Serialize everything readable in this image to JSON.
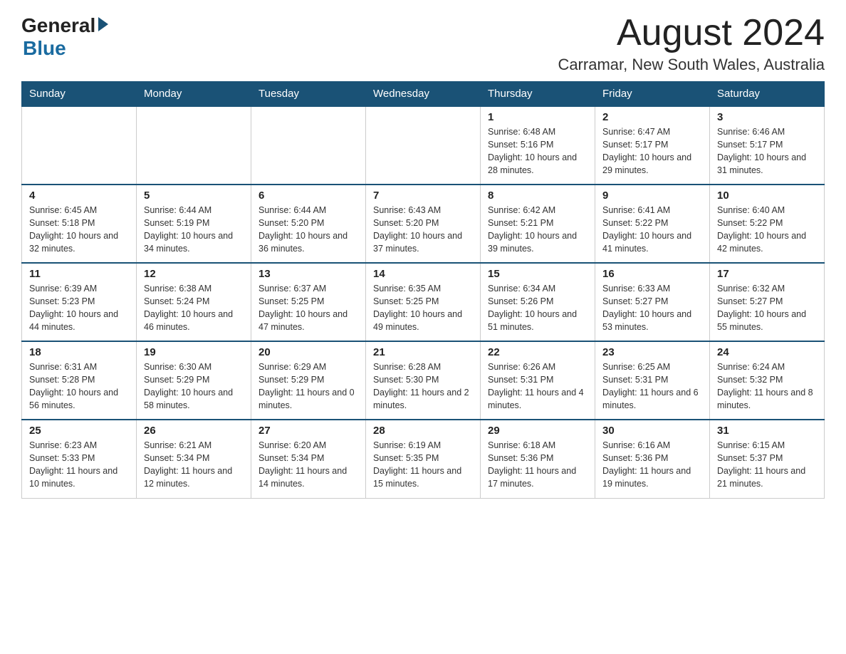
{
  "header": {
    "logo_general": "General",
    "logo_blue": "Blue",
    "month_title": "August 2024",
    "location": "Carramar, New South Wales, Australia"
  },
  "days_of_week": [
    "Sunday",
    "Monday",
    "Tuesday",
    "Wednesday",
    "Thursday",
    "Friday",
    "Saturday"
  ],
  "weeks": [
    [
      {
        "day": "",
        "info": ""
      },
      {
        "day": "",
        "info": ""
      },
      {
        "day": "",
        "info": ""
      },
      {
        "day": "",
        "info": ""
      },
      {
        "day": "1",
        "info": "Sunrise: 6:48 AM\nSunset: 5:16 PM\nDaylight: 10 hours and 28 minutes."
      },
      {
        "day": "2",
        "info": "Sunrise: 6:47 AM\nSunset: 5:17 PM\nDaylight: 10 hours and 29 minutes."
      },
      {
        "day": "3",
        "info": "Sunrise: 6:46 AM\nSunset: 5:17 PM\nDaylight: 10 hours and 31 minutes."
      }
    ],
    [
      {
        "day": "4",
        "info": "Sunrise: 6:45 AM\nSunset: 5:18 PM\nDaylight: 10 hours and 32 minutes."
      },
      {
        "day": "5",
        "info": "Sunrise: 6:44 AM\nSunset: 5:19 PM\nDaylight: 10 hours and 34 minutes."
      },
      {
        "day": "6",
        "info": "Sunrise: 6:44 AM\nSunset: 5:20 PM\nDaylight: 10 hours and 36 minutes."
      },
      {
        "day": "7",
        "info": "Sunrise: 6:43 AM\nSunset: 5:20 PM\nDaylight: 10 hours and 37 minutes."
      },
      {
        "day": "8",
        "info": "Sunrise: 6:42 AM\nSunset: 5:21 PM\nDaylight: 10 hours and 39 minutes."
      },
      {
        "day": "9",
        "info": "Sunrise: 6:41 AM\nSunset: 5:22 PM\nDaylight: 10 hours and 41 minutes."
      },
      {
        "day": "10",
        "info": "Sunrise: 6:40 AM\nSunset: 5:22 PM\nDaylight: 10 hours and 42 minutes."
      }
    ],
    [
      {
        "day": "11",
        "info": "Sunrise: 6:39 AM\nSunset: 5:23 PM\nDaylight: 10 hours and 44 minutes."
      },
      {
        "day": "12",
        "info": "Sunrise: 6:38 AM\nSunset: 5:24 PM\nDaylight: 10 hours and 46 minutes."
      },
      {
        "day": "13",
        "info": "Sunrise: 6:37 AM\nSunset: 5:25 PM\nDaylight: 10 hours and 47 minutes."
      },
      {
        "day": "14",
        "info": "Sunrise: 6:35 AM\nSunset: 5:25 PM\nDaylight: 10 hours and 49 minutes."
      },
      {
        "day": "15",
        "info": "Sunrise: 6:34 AM\nSunset: 5:26 PM\nDaylight: 10 hours and 51 minutes."
      },
      {
        "day": "16",
        "info": "Sunrise: 6:33 AM\nSunset: 5:27 PM\nDaylight: 10 hours and 53 minutes."
      },
      {
        "day": "17",
        "info": "Sunrise: 6:32 AM\nSunset: 5:27 PM\nDaylight: 10 hours and 55 minutes."
      }
    ],
    [
      {
        "day": "18",
        "info": "Sunrise: 6:31 AM\nSunset: 5:28 PM\nDaylight: 10 hours and 56 minutes."
      },
      {
        "day": "19",
        "info": "Sunrise: 6:30 AM\nSunset: 5:29 PM\nDaylight: 10 hours and 58 minutes."
      },
      {
        "day": "20",
        "info": "Sunrise: 6:29 AM\nSunset: 5:29 PM\nDaylight: 11 hours and 0 minutes."
      },
      {
        "day": "21",
        "info": "Sunrise: 6:28 AM\nSunset: 5:30 PM\nDaylight: 11 hours and 2 minutes."
      },
      {
        "day": "22",
        "info": "Sunrise: 6:26 AM\nSunset: 5:31 PM\nDaylight: 11 hours and 4 minutes."
      },
      {
        "day": "23",
        "info": "Sunrise: 6:25 AM\nSunset: 5:31 PM\nDaylight: 11 hours and 6 minutes."
      },
      {
        "day": "24",
        "info": "Sunrise: 6:24 AM\nSunset: 5:32 PM\nDaylight: 11 hours and 8 minutes."
      }
    ],
    [
      {
        "day": "25",
        "info": "Sunrise: 6:23 AM\nSunset: 5:33 PM\nDaylight: 11 hours and 10 minutes."
      },
      {
        "day": "26",
        "info": "Sunrise: 6:21 AM\nSunset: 5:34 PM\nDaylight: 11 hours and 12 minutes."
      },
      {
        "day": "27",
        "info": "Sunrise: 6:20 AM\nSunset: 5:34 PM\nDaylight: 11 hours and 14 minutes."
      },
      {
        "day": "28",
        "info": "Sunrise: 6:19 AM\nSunset: 5:35 PM\nDaylight: 11 hours and 15 minutes."
      },
      {
        "day": "29",
        "info": "Sunrise: 6:18 AM\nSunset: 5:36 PM\nDaylight: 11 hours and 17 minutes."
      },
      {
        "day": "30",
        "info": "Sunrise: 6:16 AM\nSunset: 5:36 PM\nDaylight: 11 hours and 19 minutes."
      },
      {
        "day": "31",
        "info": "Sunrise: 6:15 AM\nSunset: 5:37 PM\nDaylight: 11 hours and 21 minutes."
      }
    ]
  ]
}
